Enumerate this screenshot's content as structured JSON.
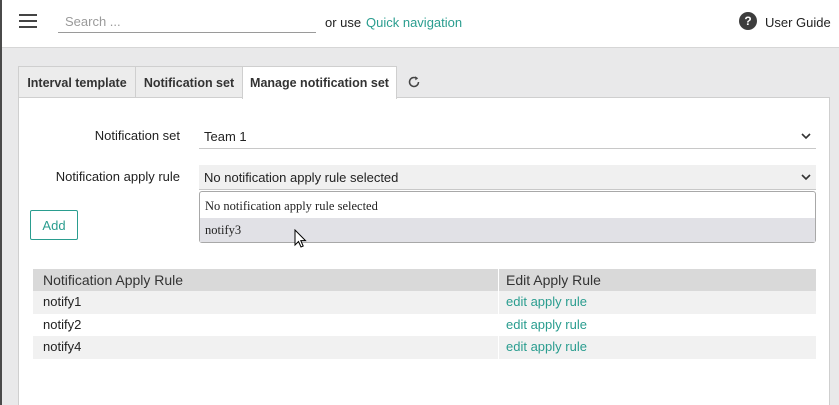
{
  "header": {
    "search_placeholder": "Search ...",
    "or_use": "or use",
    "quick_navigation": "Quick navigation",
    "help_icon_glyph": "?",
    "user_guide": "User Guide"
  },
  "tabs": [
    {
      "label": "Interval template"
    },
    {
      "label": "Notification set"
    },
    {
      "label": "Manage notification set"
    }
  ],
  "form": {
    "notification_set_label": "Notification set",
    "notification_set_value": "Team 1",
    "apply_rule_label": "Notification apply rule",
    "apply_rule_value": "No notification apply rule selected",
    "dropdown_options": [
      "No notification apply rule selected",
      "notify3"
    ],
    "add_button": "Add"
  },
  "table": {
    "headers": [
      "Notification Apply Rule",
      "Edit Apply Rule"
    ],
    "rows": [
      {
        "rule": "notify1",
        "action": "edit apply rule"
      },
      {
        "rule": "notify2",
        "action": "edit apply rule"
      },
      {
        "rule": "notify4",
        "action": "edit apply rule"
      }
    ]
  },
  "colors": {
    "accent": "#2a9d8f",
    "header_bg": "#ffffff",
    "page_bg": "#e9e9ea",
    "table_header_bg": "#d9d9d9"
  },
  "icons": {
    "menu": "hamburger-menu-icon",
    "help": "help-circle-icon",
    "refresh": "refresh-icon",
    "chevron": "chevron-down-icon"
  }
}
